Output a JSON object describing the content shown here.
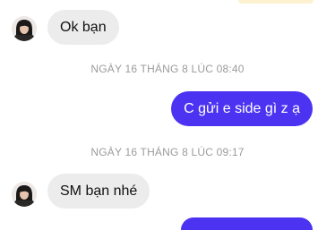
{
  "thread": {
    "messages": [
      {
        "direction": "incoming",
        "text": "Ok bạn"
      },
      {
        "direction": "outgoing",
        "text": "C gửi e side gì z ạ"
      },
      {
        "direction": "incoming",
        "text": "SM bạn nhé"
      },
      {
        "direction": "outgoing",
        "text": ""
      }
    ],
    "timestamps": [
      "NGÀY 16 THÁNG 8 LÚC 08:40",
      "NGÀY 16 THÁNG 8 LÚC 09:17"
    ]
  },
  "colors": {
    "outgoing_bubble": "#4c33f2",
    "incoming_bubble": "#ececec",
    "timestamp_text": "#9b9b9b",
    "background": "#ffffff"
  },
  "icons": {
    "contact_avatar": "avatar"
  }
}
